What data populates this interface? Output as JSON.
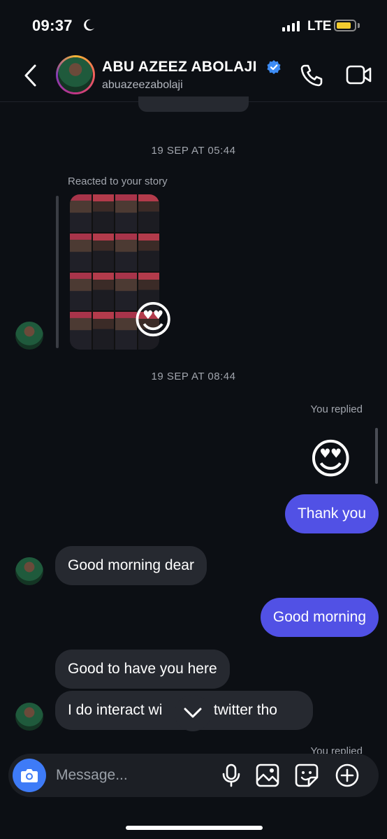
{
  "status_bar": {
    "time": "09:37",
    "network": "LTE",
    "battery_level": 0.75
  },
  "header": {
    "name": "ABU AZEEZ ABOLAJI",
    "username": "abuazeezabolaji",
    "verified": true,
    "icons": {
      "back": "chevron-left-icon",
      "call": "phone-icon",
      "video": "video-camera-icon"
    }
  },
  "messages": {
    "timestamp_1": "19 SEP AT 05:44",
    "reacted_label": "Reacted to your story",
    "reaction_emoji": "😍",
    "timestamp_2": "19 SEP AT 08:44",
    "you_replied_1": "You replied",
    "replied_emoji": "😍",
    "thank_you": "Thank you",
    "good_morning_dear": "Good morning dear",
    "good_morning": "Good morning",
    "good_to_have": "Good to have you here",
    "interact_left": "I do interact wi",
    "interact_right": "n twitter tho",
    "you_replied_2": "You replied"
  },
  "composer": {
    "placeholder": "Message...",
    "icons": [
      "camera-icon",
      "microphone-icon",
      "image-icon",
      "sticker-icon",
      "plus-icon"
    ]
  },
  "colors": {
    "outgoing_bubble": "#5151e5",
    "incoming_bubble": "#262930",
    "camera_button": "#3e7bf7",
    "background": "#0c0f14"
  }
}
